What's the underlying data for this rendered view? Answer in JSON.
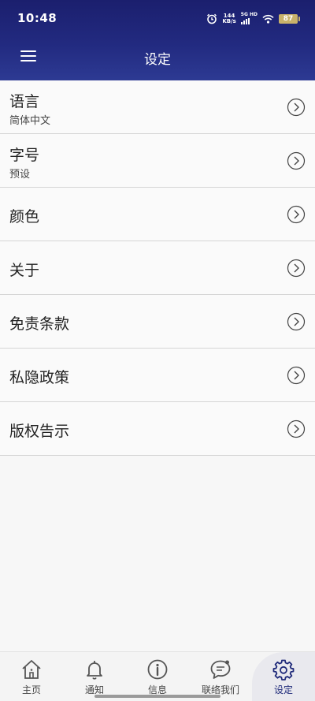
{
  "status": {
    "time": "10:48",
    "speed_value": "144",
    "speed_unit": "KB/s",
    "network": "5G HD",
    "battery": "87"
  },
  "header": {
    "title": "设定",
    "menu_icon": "hamburger-menu-icon"
  },
  "settings": [
    {
      "label": "语言",
      "sub": "简体中文"
    },
    {
      "label": "字号",
      "sub": "预设"
    },
    {
      "label": "颜色"
    },
    {
      "label": "关于"
    },
    {
      "label": "免责条款"
    },
    {
      "label": "私隐政策"
    },
    {
      "label": "版权告示"
    }
  ],
  "tabs": [
    {
      "label": "主页",
      "icon": "home-icon"
    },
    {
      "label": "通知",
      "icon": "bell-icon"
    },
    {
      "label": "信息",
      "icon": "info-icon"
    },
    {
      "label": "联络我们",
      "icon": "chat-icon"
    },
    {
      "label": "设定",
      "icon": "gear-icon",
      "active": true
    }
  ],
  "colors": {
    "header": "#222a80",
    "active_tab": "#1f2a7a",
    "battery": "#c9b26a"
  }
}
